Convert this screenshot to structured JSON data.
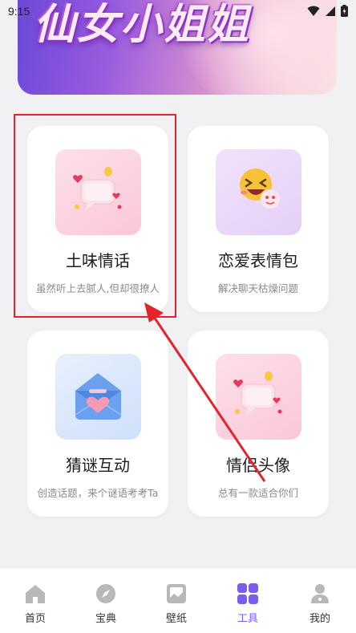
{
  "status_bar": {
    "time": "9:15"
  },
  "banner": {
    "title": "仙女小姐姐"
  },
  "cards": [
    {
      "title": "土味情话",
      "subtitle": "虽然听上去腻人,但却很撩人"
    },
    {
      "title": "恋爱表情包",
      "subtitle": "解决聊天枯燥问题"
    },
    {
      "title": "猜谜互动",
      "subtitle": "创造话题，来个谜语考考Ta"
    },
    {
      "title": "情侣头像",
      "subtitle": "总有一款适合你们"
    }
  ],
  "nav": {
    "items": [
      {
        "label": "首页",
        "icon": "home-icon"
      },
      {
        "label": "宝典",
        "icon": "compass-icon"
      },
      {
        "label": "壁纸",
        "icon": "wallpaper-icon"
      },
      {
        "label": "工具",
        "icon": "tools-grid-icon"
      },
      {
        "label": "我的",
        "icon": "profile-icon"
      }
    ],
    "active_index": 3
  },
  "colors": {
    "accent": "#7b5cf0",
    "highlight": "#e3242b",
    "background": "#f1f1f4"
  }
}
